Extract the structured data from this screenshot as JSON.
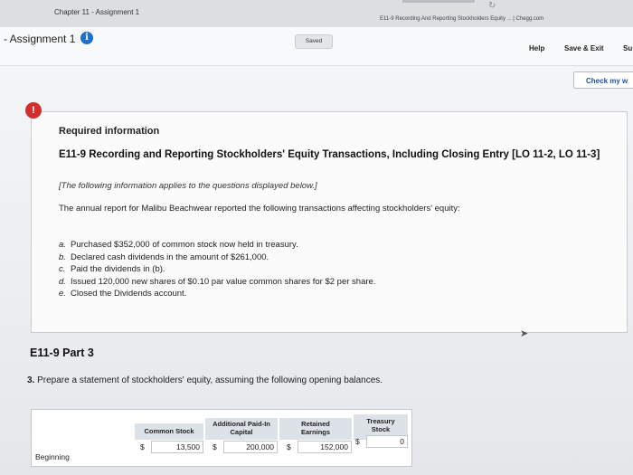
{
  "browser": {
    "tab_left": "Chapter 11 - Assignment 1",
    "tab_right": "E11-9 Recording And Reporting Stockholders Equity ... | Chegg.com"
  },
  "header": {
    "assignment_title": "- Assignment 1",
    "saved": "Saved",
    "help": "Help",
    "save_exit": "Save & Exit",
    "submit": "Su",
    "check": "Check my w"
  },
  "required": {
    "label": "Required information",
    "title": "E11-9 Recording and Reporting Stockholders' Equity Transactions, Including Closing Entry [LO 11-2, LO 11-3]",
    "note": "[The following information applies to the questions displayed below.]",
    "intro": "The annual report for Malibu Beachwear reported the following transactions affecting stockholders' equity:",
    "items": [
      {
        "letter": "a.",
        "text": "Purchased $352,000 of common stock now held in treasury."
      },
      {
        "letter": "b.",
        "text": "Declared cash dividends in the amount of $261,000."
      },
      {
        "letter": "c.",
        "text": "Paid the dividends in (b)."
      },
      {
        "letter": "d.",
        "text": "Issued 120,000 new shares of $0.10 par value common shares for $2 per share."
      },
      {
        "letter": "e.",
        "text": "Closed the Dividends account."
      }
    ]
  },
  "part3": {
    "title": "E11-9 Part 3",
    "question_num": "3.",
    "question": "Prepare a statement of stockholders' equity, assuming the following opening balances."
  },
  "table": {
    "headers": [
      "Common Stock",
      "Additional Paid-In Capital",
      "Retained Earnings",
      "Treasury Stock"
    ],
    "row_label": "Beginning",
    "currency": "$",
    "values": [
      "13,500",
      "200,000",
      "152,000",
      "0"
    ]
  }
}
